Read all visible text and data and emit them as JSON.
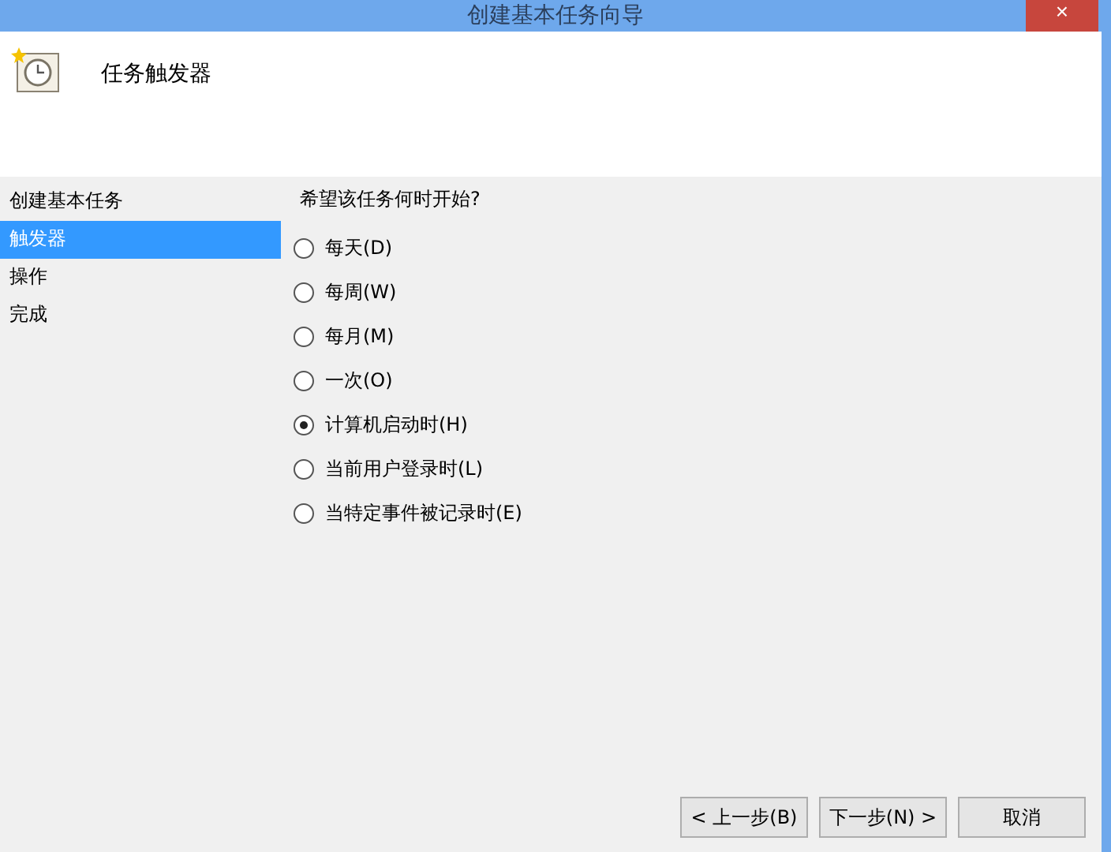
{
  "window": {
    "title": "创建基本任务向导",
    "close": "×"
  },
  "header": {
    "title": "任务触发器"
  },
  "sidebar": {
    "items": [
      {
        "label": "创建基本任务",
        "selected": false
      },
      {
        "label": "触发器",
        "selected": true
      },
      {
        "label": "操作",
        "selected": false
      },
      {
        "label": "完成",
        "selected": false
      }
    ]
  },
  "question": "希望该任务何时开始?",
  "options": [
    {
      "label": "每天(D)",
      "selected": false
    },
    {
      "label": "每周(W)",
      "selected": false
    },
    {
      "label": "每月(M)",
      "selected": false
    },
    {
      "label": "一次(O)",
      "selected": false
    },
    {
      "label": "计算机启动时(H)",
      "selected": true
    },
    {
      "label": "当前用户登录时(L)",
      "selected": false
    },
    {
      "label": "当特定事件被记录时(E)",
      "selected": false
    }
  ],
  "buttons": [
    "< 上一步(B)",
    "下一步(N) >",
    "取消"
  ]
}
